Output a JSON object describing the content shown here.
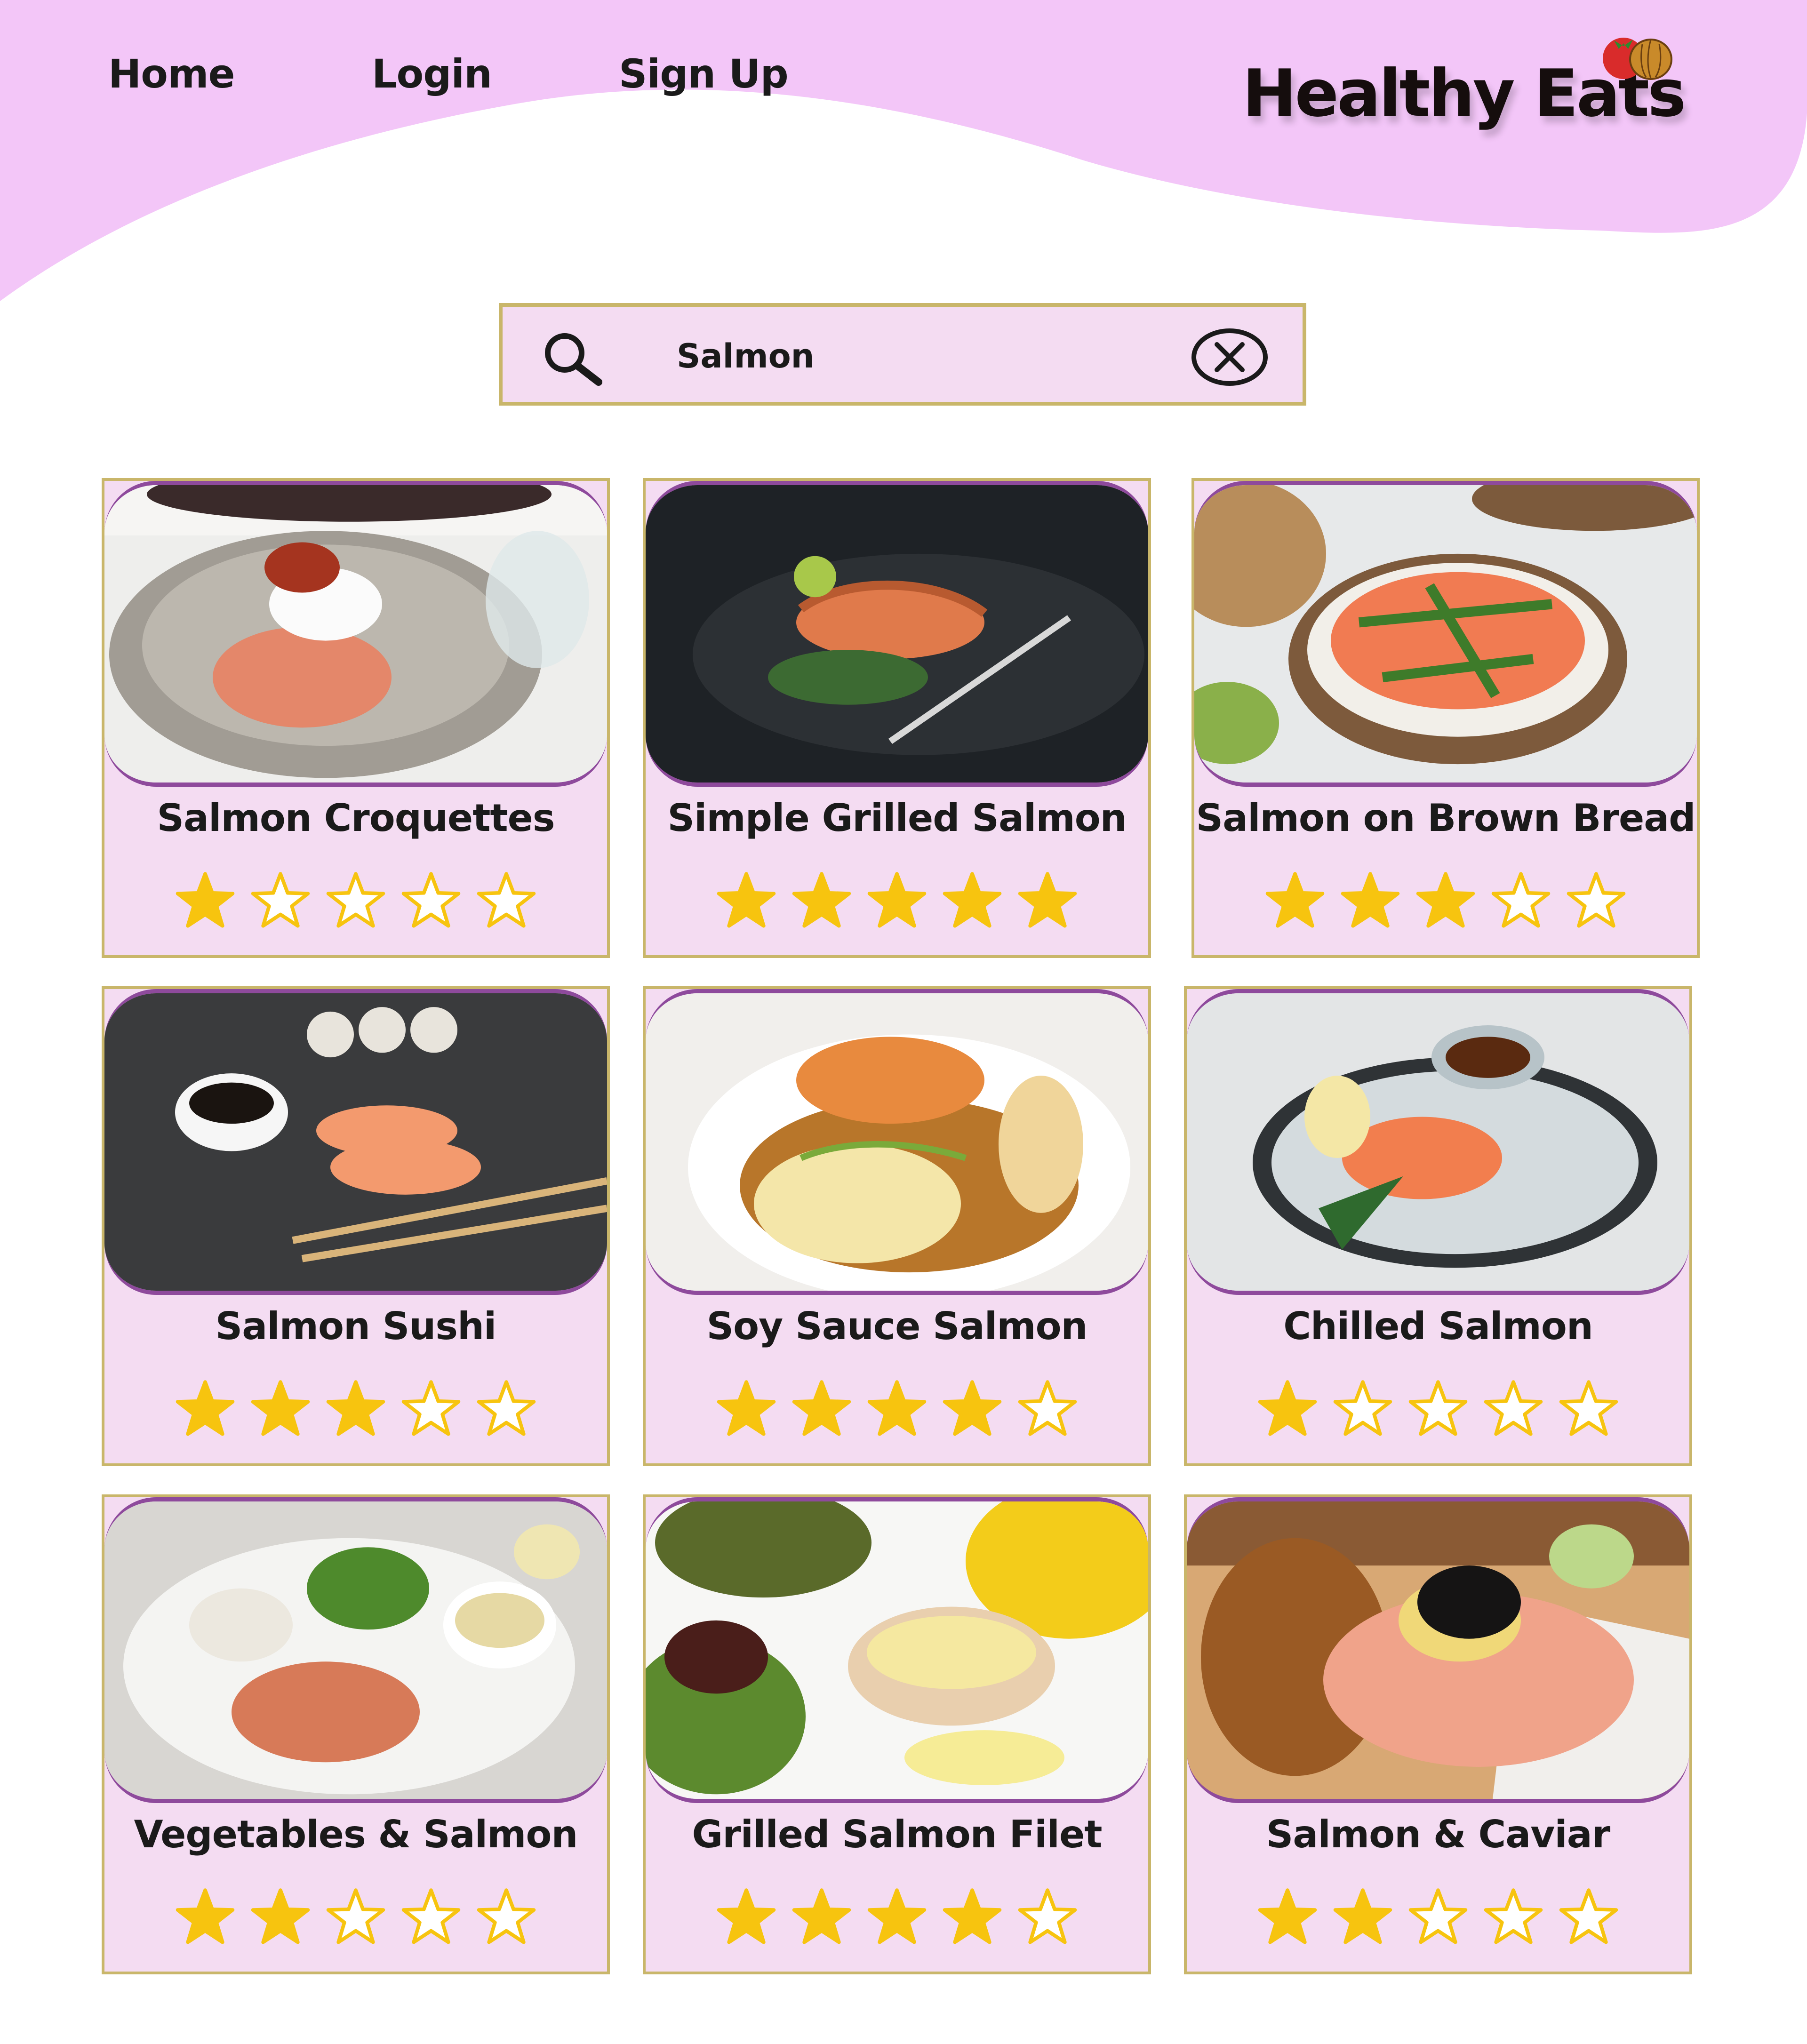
{
  "nav": {
    "home": "Home",
    "login": "Login",
    "signup": "Sign Up"
  },
  "brand": {
    "name": "Healthy Eats",
    "accent": "#f3c6f8"
  },
  "search": {
    "value": "Salmon",
    "placeholder": ""
  },
  "results": [
    {
      "title": "Salmon Croquettes",
      "rating": 1,
      "photo": "salmon-croquettes-photo"
    },
    {
      "title": "Simple Grilled Salmon",
      "rating": 5,
      "photo": "simple-grilled-salmon-photo"
    },
    {
      "title": "Salmon on Brown Bread",
      "rating": 3,
      "photo": "salmon-brown-bread-photo"
    },
    {
      "title": "Salmon Sushi",
      "rating": 3,
      "photo": "salmon-sushi-photo"
    },
    {
      "title": "Soy Sauce Salmon",
      "rating": 4,
      "photo": "soy-sauce-salmon-photo"
    },
    {
      "title": "Chilled Salmon",
      "rating": 1,
      "photo": "chilled-salmon-photo"
    },
    {
      "title": "Vegetables & Salmon",
      "rating": 2,
      "photo": "vegetables-salmon-photo"
    },
    {
      "title": "Grilled Salmon Filet",
      "rating": 4,
      "photo": "grilled-salmon-filet-photo"
    },
    {
      "title": "Salmon & Caviar",
      "rating": 2,
      "photo": "salmon-caviar-photo"
    }
  ],
  "colors": {
    "card_bg": "#f4dcf2",
    "card_border": "#c9b66a",
    "photo_border": "#8e4a9c",
    "star": "#f7c40f"
  }
}
